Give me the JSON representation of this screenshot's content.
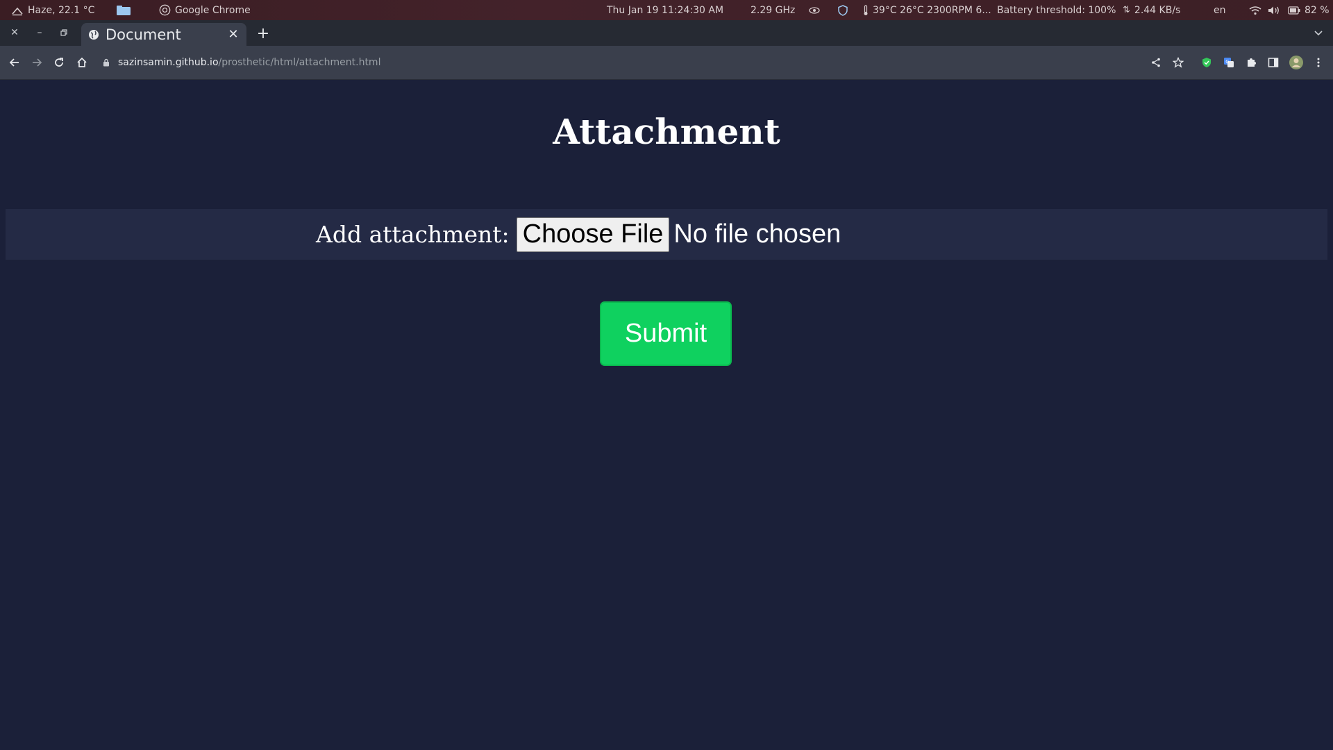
{
  "system_bar": {
    "weather": "Haze, 22.1 °C",
    "active_app": "Google Chrome",
    "datetime": "Thu Jan 19  11:24:30 AM",
    "cpu_freq": "2.29 GHz",
    "sensors": "39°C 26°C 2300RPM 6...",
    "battery_threshold": "Battery threshold: 100%",
    "net_speed": "2.44 KB/s",
    "keyboard_layout": "en",
    "battery": "82 %"
  },
  "browser": {
    "tab_title": "Document",
    "url_host": "sazinsamin.github.io",
    "url_path": "/prosthetic/html/attachment.html"
  },
  "page": {
    "heading": "Attachment",
    "attachment_label": "Add attachment:",
    "choose_file_label": "Choose File",
    "no_file_text": "No file chosen",
    "submit_label": "Submit"
  },
  "colors": {
    "page_background": "#1b2039",
    "field_row_background": "#242a45",
    "submit_green": "#0fd15f"
  }
}
